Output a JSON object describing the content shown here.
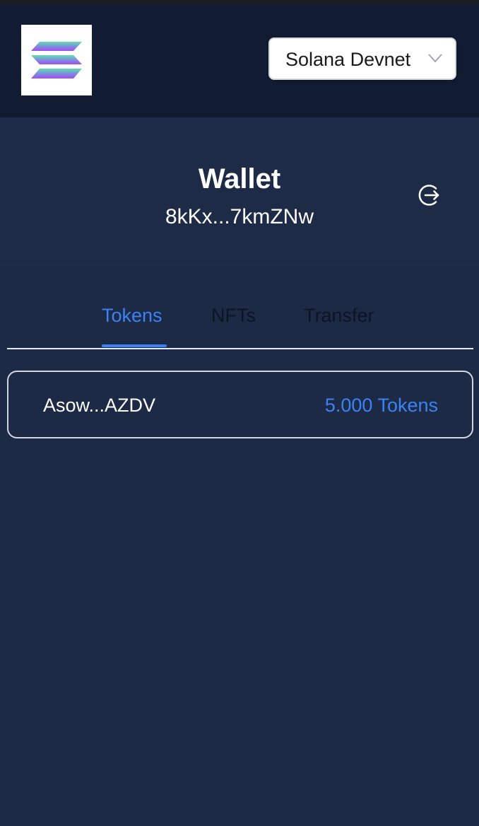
{
  "header": {
    "logo_icon": "solana-logo-icon",
    "network": {
      "selected": "Solana Devnet",
      "chevron_icon": "chevron-down-icon"
    }
  },
  "wallet": {
    "title": "Wallet",
    "address": "8kKx...7kmZNw",
    "logout_icon": "logout-icon"
  },
  "tabs": [
    {
      "label": "Tokens",
      "active": true
    },
    {
      "label": "NFTs",
      "active": false
    },
    {
      "label": "Transfer",
      "active": false
    }
  ],
  "tokens": [
    {
      "address": "Asow...AZDV",
      "amount": "5.000 Tokens"
    }
  ],
  "colors": {
    "background": "#1c2a46",
    "header": "#111c33",
    "accent": "#3b82f6",
    "text": "#ffffff"
  }
}
